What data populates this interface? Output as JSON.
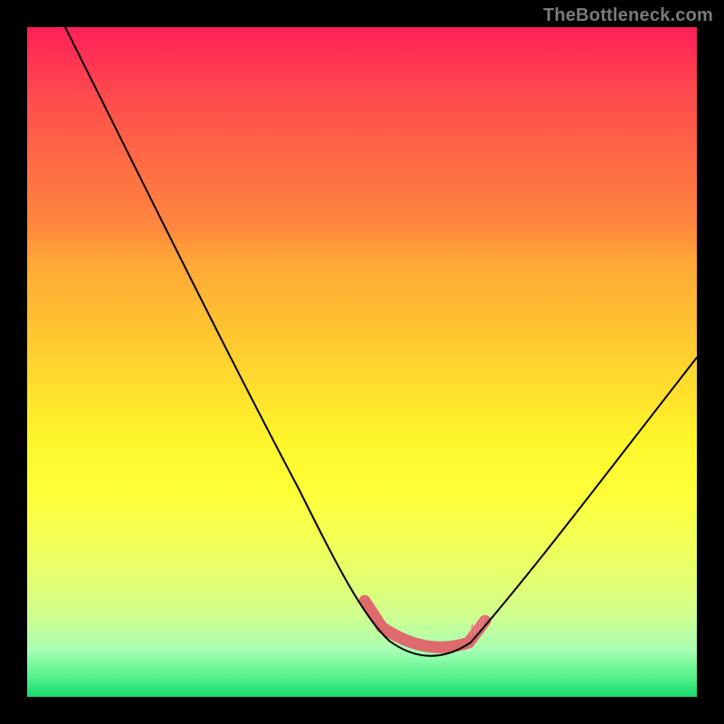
{
  "attribution": "TheBottleneck.com",
  "colors": {
    "bg": "#000000",
    "gradient_top": "#ff1f58",
    "gradient_bottom": "#17d96e",
    "curve": "#000000",
    "good_zone": "#de6a6e"
  },
  "chart_data": {
    "type": "line",
    "title": "",
    "xlabel": "",
    "ylabel": "",
    "xlim": [
      0,
      1
    ],
    "ylim": [
      0,
      1
    ],
    "x": [
      0.0,
      0.05,
      0.1,
      0.15,
      0.2,
      0.25,
      0.3,
      0.35,
      0.4,
      0.45,
      0.5,
      0.53,
      0.56,
      0.6,
      0.63,
      0.66,
      0.7,
      0.75,
      0.8,
      0.85,
      0.9,
      0.95,
      1.0
    ],
    "y": [
      1.0,
      0.9,
      0.8,
      0.7,
      0.61,
      0.52,
      0.43,
      0.35,
      0.27,
      0.2,
      0.14,
      0.1,
      0.08,
      0.065,
      0.06,
      0.065,
      0.08,
      0.12,
      0.19,
      0.27,
      0.35,
      0.43,
      0.51
    ],
    "good_x_range": [
      0.5,
      0.68
    ],
    "good_y_level": 0.065,
    "series_note": "y is fraction of plot height from bottom; curve shows a V/valley shape with flat optimum around x≈0.55–0.66"
  }
}
